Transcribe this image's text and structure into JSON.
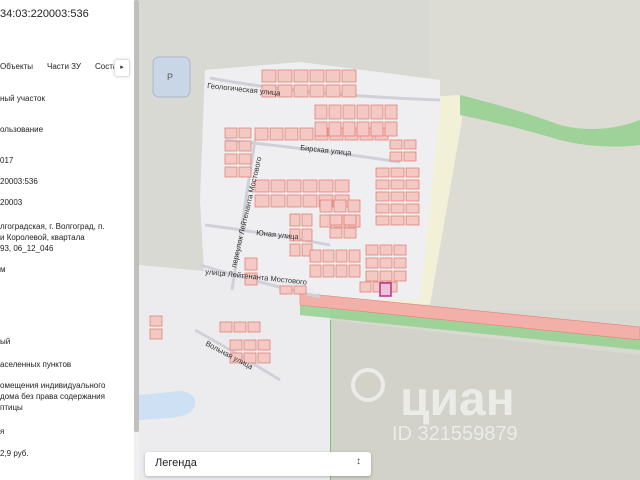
{
  "panel": {
    "title": "34:03:220003:536",
    "tabs": [
      "Объекты",
      "Части ЗУ",
      "Соста"
    ],
    "tab_next": "▸",
    "rows": [
      "ный участок",
      "ользование",
      "017",
      "20003:536",
      "20003",
      "лгоградская, г. Волгоград, п.",
      "и Королевой, квартала",
      "93, 06_12_046",
      "м",
      "ый",
      "аселенных пунктов",
      "омещения индивидуального",
      "дома без права содержания",
      "птицы",
      "я",
      "2,9 руб."
    ]
  },
  "map": {
    "streets": [
      "Геологическая улица",
      "Бирская улица",
      "Юная улица",
      "переулок Лейтенанта Мостового",
      "улица Лейтенанта Мостового",
      "Вольная улица"
    ],
    "parking_label": "P",
    "watermark": "циан",
    "watermark_id": "ID 321559879",
    "colors": {
      "parcel_fill": "#f5c9c3",
      "parcel_stroke": "#e0837a",
      "selected_parcel": "#b5338a",
      "field": "#f3f0d8",
      "rail": "#f2b0a8",
      "green": "#7cc27a"
    }
  },
  "legend": {
    "label": "Легенда",
    "chevron": "⌃⌄"
  }
}
